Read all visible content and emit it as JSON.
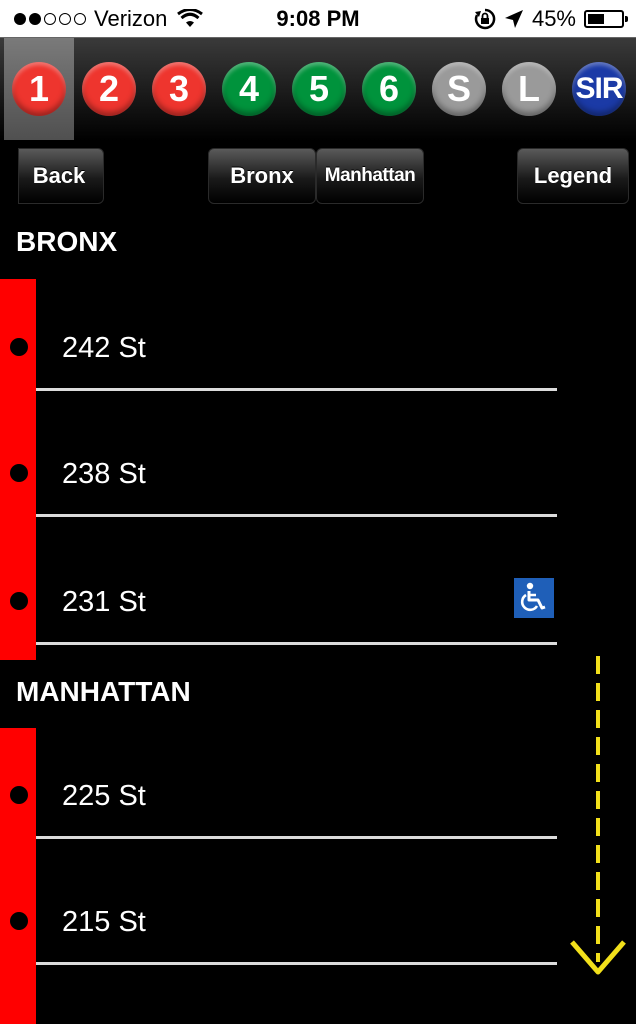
{
  "status_bar": {
    "carrier": "Verizon",
    "time": "9:08 PM",
    "battery": "45%",
    "battery_level": 0.45,
    "signal_bars": 2,
    "icons": [
      "wifi-icon",
      "rotation-lock-icon",
      "location-arrow-icon",
      "battery-icon"
    ]
  },
  "lines": [
    {
      "label": "1",
      "color": "#ee352e",
      "selected": true
    },
    {
      "label": "2",
      "color": "#ee352e"
    },
    {
      "label": "3",
      "color": "#ee352e"
    },
    {
      "label": "4",
      "color": "#00933c"
    },
    {
      "label": "5",
      "color": "#00933c"
    },
    {
      "label": "6",
      "color": "#00933c"
    },
    {
      "label": "S",
      "color": "#9a9a9a"
    },
    {
      "label": "L",
      "color": "#9a9a9a"
    },
    {
      "label": "SIR",
      "color": "#1b3aa6"
    }
  ],
  "nav": {
    "back_label": "Back",
    "bronx_label": "Bronx",
    "manhattan_label": "Manhattan",
    "legend_label": "Legend"
  },
  "sections": [
    {
      "title": "BRONX",
      "stations": [
        {
          "name": "242 St",
          "accessible": false
        },
        {
          "name": "238 St",
          "accessible": false
        },
        {
          "name": "231 St",
          "accessible": true
        }
      ]
    },
    {
      "title": "MANHATTAN",
      "stations": [
        {
          "name": "225 St",
          "accessible": false
        },
        {
          "name": "215 St",
          "accessible": false
        }
      ]
    }
  ],
  "colors": {
    "route_line": "#ff0000",
    "scroll_hint": "#f2e01b",
    "accessible_badge": "#1f5fb8"
  }
}
